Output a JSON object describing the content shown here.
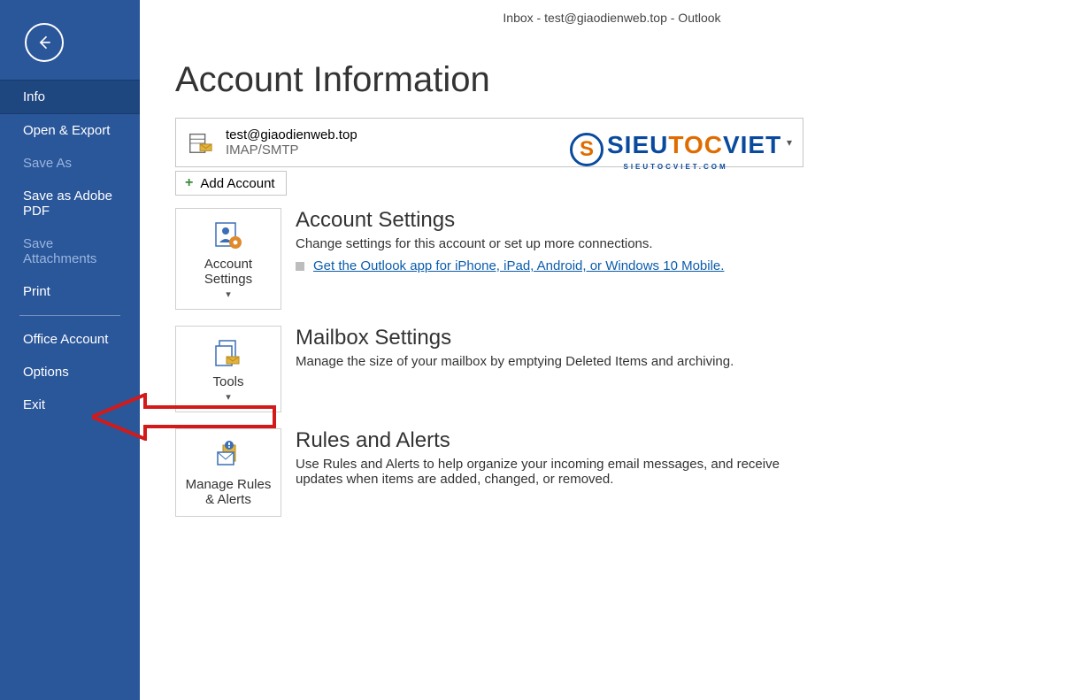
{
  "header": {
    "title": "Inbox - test@giaodienweb.top  -  Outlook"
  },
  "sidebar": {
    "items": [
      {
        "label": "Info",
        "selected": true,
        "dim": false
      },
      {
        "label": "Open & Export",
        "selected": false,
        "dim": false
      },
      {
        "label": "Save As",
        "selected": false,
        "dim": true
      },
      {
        "label": "Save as Adobe PDF",
        "selected": false,
        "dim": false
      },
      {
        "label": "Save Attachments",
        "selected": false,
        "dim": true
      },
      {
        "label": "Print",
        "selected": false,
        "dim": false
      }
    ],
    "footer_items": [
      {
        "label": "Office Account",
        "selected": false
      },
      {
        "label": "Options",
        "selected": false
      },
      {
        "label": "Exit",
        "selected": false
      }
    ]
  },
  "page": {
    "title": "Account Information"
  },
  "account_dropdown": {
    "email": "test@giaodienweb.top",
    "protocol": "IMAP/SMTP"
  },
  "add_account": {
    "label": "Add Account"
  },
  "sections": {
    "account_settings": {
      "button_label": "Account Settings",
      "title": "Account Settings",
      "desc": "Change settings for this account or set up more connections.",
      "link": "Get the Outlook app for iPhone, iPad, Android, or Windows 10 Mobile."
    },
    "mailbox_settings": {
      "button_label": "Tools",
      "title": "Mailbox Settings",
      "desc": "Manage the size of your mailbox by emptying Deleted Items and archiving."
    },
    "rules_alerts": {
      "button_label": "Manage Rules & Alerts",
      "title": "Rules and Alerts",
      "desc": "Use Rules and Alerts to help organize your incoming email messages, and receive updates when items are added, changed, or removed."
    }
  },
  "watermark": {
    "text_main": "SIEUTOCVIET",
    "text_sub": "SIEUTOCVIET.COM",
    "badge": "S"
  },
  "annotation": {
    "arrow_target": "Options"
  }
}
